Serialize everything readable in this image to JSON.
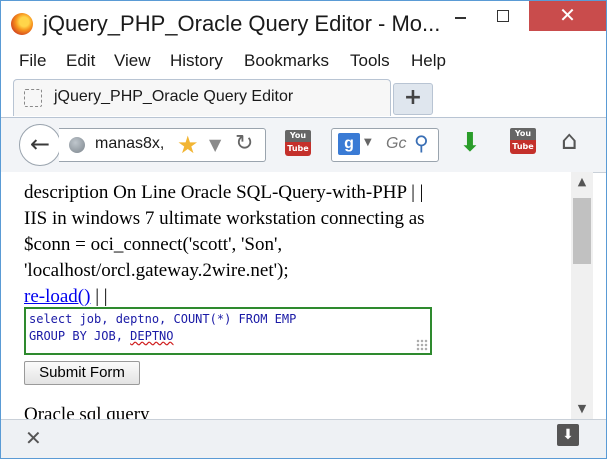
{
  "window": {
    "title": "jQuery_PHP_Oracle Query Editor - Mo...",
    "close_glyph": "✕"
  },
  "menu": {
    "items": [
      "File",
      "Edit",
      "View",
      "History",
      "Bookmarks",
      "Tools",
      "Help"
    ]
  },
  "tab": {
    "title": "jQuery_PHP_Oracle Query Editor",
    "new_tab_label": "+"
  },
  "nav": {
    "url": "manas8x,",
    "search_placeholder": "Gc",
    "youtube_top": "You",
    "youtube_bottom": "Tube"
  },
  "content": {
    "lines": [
      "description On Line Oracle SQL-Query-with-PHP | |",
      "IIS in windows 7 ultimate workstation connecting as",
      "$conn = oci_connect('scott', 'Son',",
      "'localhost/orcl.gateway.2wire.net');"
    ],
    "reload_link": "re-load()",
    "reload_suffix": " | |",
    "sql_line1": "select job, deptno, COUNT(*) FROM EMP",
    "sql_line2_prefix": "GROUP BY JOB, ",
    "sql_line2_misspelled": "DEPTNO",
    "submit_label": "Submit Form",
    "cut_text": "Oracle sql query"
  }
}
